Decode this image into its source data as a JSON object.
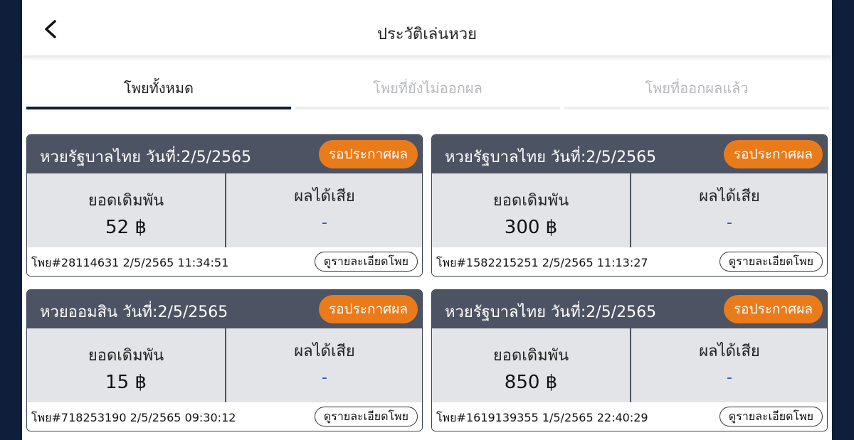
{
  "header": {
    "title": "ประวัติเล่นหวย",
    "back_icon": "chevron-left-icon"
  },
  "tabs": [
    {
      "label": "โพยทั้งหมด",
      "active": true
    },
    {
      "label": "โพยที่ยังไม่ออกผล",
      "active": false
    },
    {
      "label": "โพยที่ออกผลแล้ว",
      "active": false
    }
  ],
  "labels": {
    "stake": "ยอดเดิมพัน",
    "result": "ผลได้เสีย",
    "detail_button": "ดูรายละเอียดโพย"
  },
  "colors": {
    "badge": "#ea7b1a",
    "card_header": "#4c5362",
    "active_tab": "#0f1e3a"
  },
  "cards": [
    {
      "title": "หวยรัฐบาลไทย วันที่:2/5/2565",
      "status": "รอประกาศผล",
      "stake": "52 ฿",
      "result": "-",
      "ticket": "โพย#28114631 2/5/2565 11:34:51"
    },
    {
      "title": "หวยรัฐบาลไทย วันที่:2/5/2565",
      "status": "รอประกาศผล",
      "stake": "300 ฿",
      "result": "-",
      "ticket": "โพย#1582215251 2/5/2565 11:13:27"
    },
    {
      "title": "หวยออมสิน วันที่:2/5/2565",
      "status": "รอประกาศผล",
      "stake": "15 ฿",
      "result": "-",
      "ticket": "โพย#718253190 2/5/2565 09:30:12"
    },
    {
      "title": "หวยรัฐบาลไทย วันที่:2/5/2565",
      "status": "รอประกาศผล",
      "stake": "850 ฿",
      "result": "-",
      "ticket": "โพย#1619139355 1/5/2565 22:40:29"
    }
  ]
}
